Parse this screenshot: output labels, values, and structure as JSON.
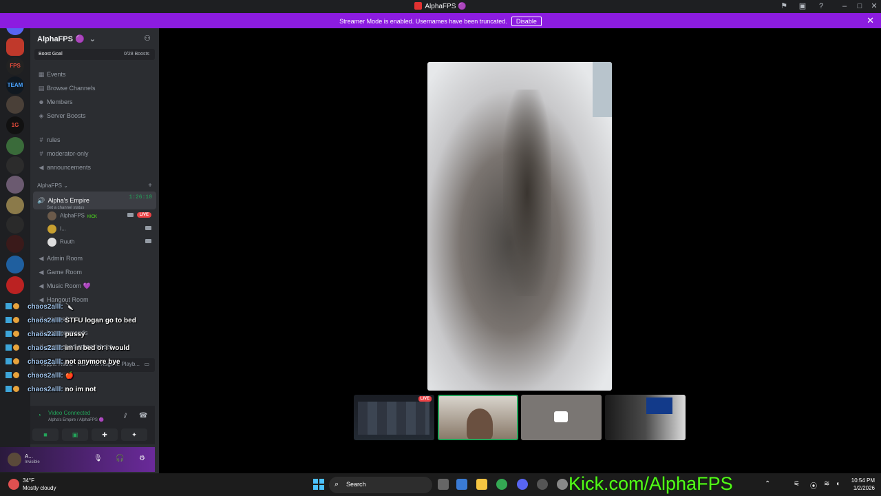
{
  "window": {
    "title": "AlphaFPS 🟣"
  },
  "banner": {
    "message": "Streamer Mode is enabled. Usernames have been truncated.",
    "disable_label": "Disable"
  },
  "server": {
    "name": "AlphaFPS 🟣",
    "boost_goal_label": "Boost Goal",
    "boost_count": "0/28 Boosts",
    "nav": [
      {
        "label": "Events",
        "icon": "calendar-icon"
      },
      {
        "label": "Browse Channels",
        "icon": "browse-icon"
      },
      {
        "label": "Members",
        "icon": "members-icon"
      },
      {
        "label": "Server Boosts",
        "icon": "boost-icon"
      }
    ],
    "channels_top": [
      {
        "label": "rules",
        "icon": "hash-icon"
      },
      {
        "label": "moderator-only",
        "icon": "hash-icon"
      },
      {
        "label": "announcements",
        "icon": "megaphone-icon"
      }
    ],
    "category": "AlphaFPS",
    "active_voice": {
      "name": "Alpha's Empire",
      "timer": "1:26:10",
      "status": "Set a channel status"
    },
    "voice_users": [
      {
        "name": "AlphaFPS",
        "badge": "KICK",
        "live": "LIVE"
      },
      {
        "name": "I..."
      },
      {
        "name": "Ruuth"
      }
    ],
    "voice_rooms": [
      {
        "label": "Admin Room"
      },
      {
        "label": "Game Room"
      },
      {
        "label": "Music Room 💜"
      },
      {
        "label": "Hangout Room"
      }
    ],
    "text_channels": [
      {
        "label": "general"
      },
      {
        "label": "bot-commands"
      },
      {
        "label": "mousepad-spreadsheet"
      }
    ],
    "now_playing": "Ripple Radio · Kiss The Rage ft. Playb..."
  },
  "voice_panel": {
    "status": "Video Connected",
    "location": "Alpha's Empire / AlphaFPS 🟣"
  },
  "user": {
    "name": "A...",
    "status": "Invisible"
  },
  "chat_overlay": [
    {
      "user": "chaos2alll:",
      "text": "🔪"
    },
    {
      "user": "chaos2alll:",
      "text": "STFU logan go to bed"
    },
    {
      "user": "chaos2alll:",
      "text": "pussy"
    },
    {
      "user": "chaos2alll:",
      "text": "im in bed or i would"
    },
    {
      "user": "chaos2alll:",
      "text": "not anymore bye"
    },
    {
      "user": "chaos2alll:",
      "text": "🍎"
    },
    {
      "user": "chaos2alll:",
      "text": "no im not"
    }
  ],
  "stage": {
    "thumb_live_badge": "LIVE"
  },
  "taskbar": {
    "temperature": "34°F",
    "condition": "Mostly cloudy",
    "search_label": "Search",
    "overlay_link": "Kick.com/AlphaFPS",
    "time": "10:54 PM",
    "date": "1/2/2026"
  },
  "colors": {
    "accent": "#8c1ce0",
    "kick_green": "#53fc18",
    "voice_green": "#23a55a",
    "live_red": "#ed4245"
  }
}
